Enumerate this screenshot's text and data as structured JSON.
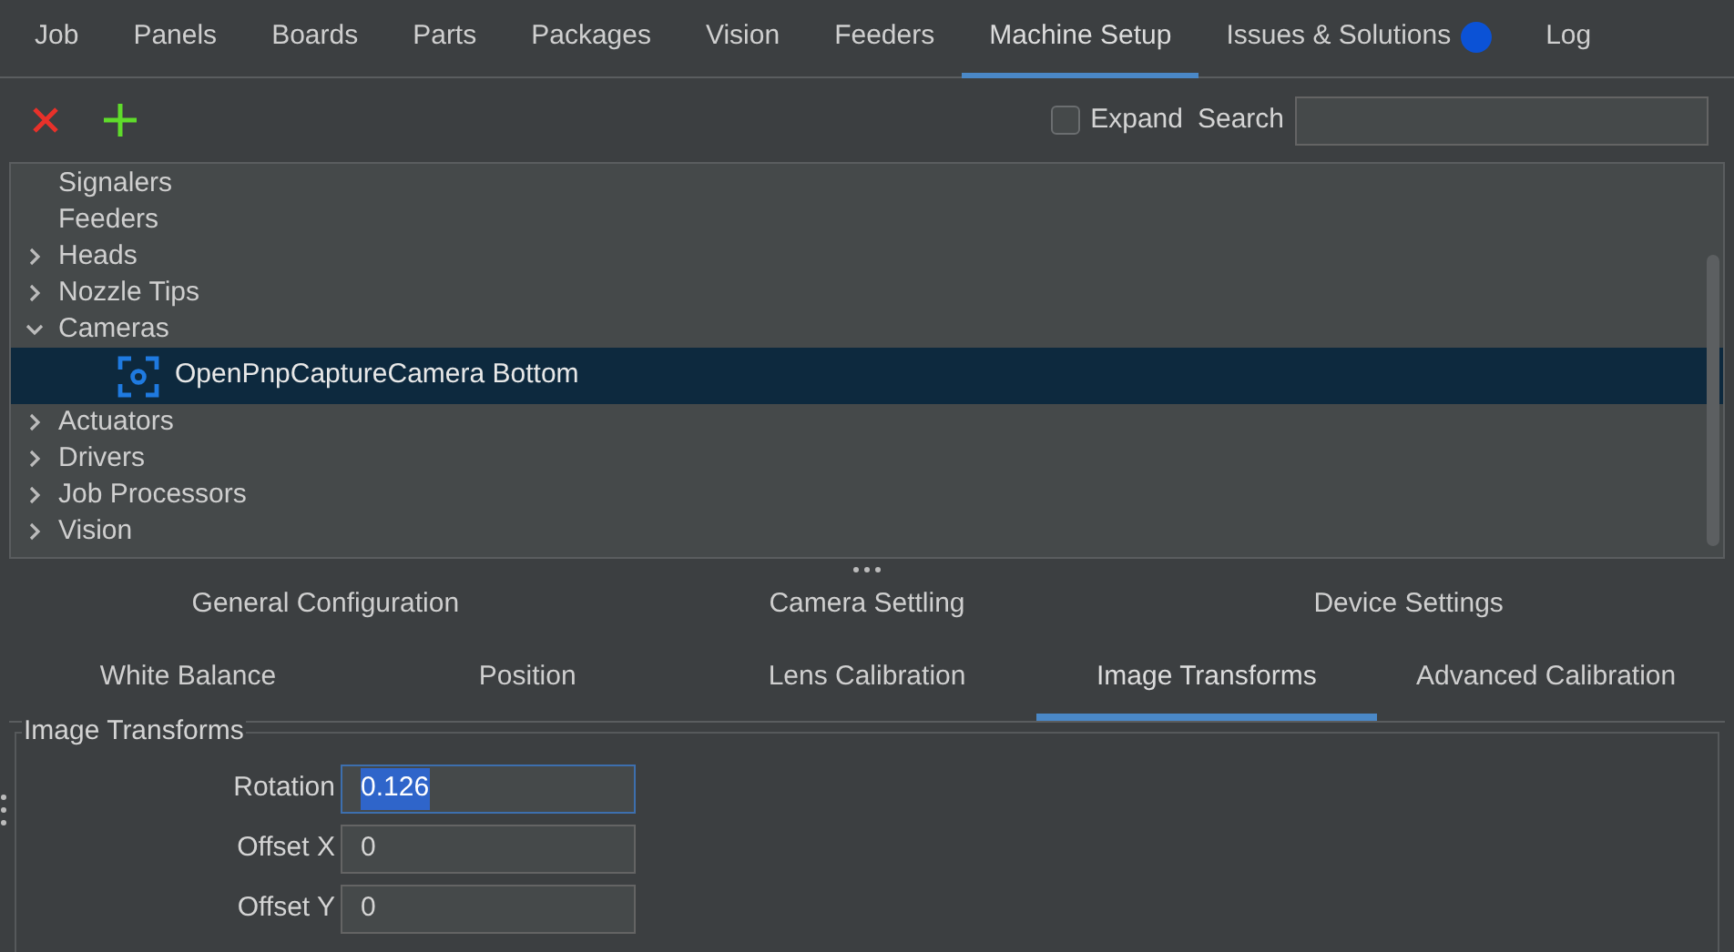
{
  "tabs": [
    {
      "label": "Job",
      "selected": false
    },
    {
      "label": "Panels",
      "selected": false
    },
    {
      "label": "Boards",
      "selected": false
    },
    {
      "label": "Parts",
      "selected": false
    },
    {
      "label": "Packages",
      "selected": false
    },
    {
      "label": "Vision",
      "selected": false
    },
    {
      "label": "Feeders",
      "selected": false
    },
    {
      "label": "Machine Setup",
      "selected": true
    },
    {
      "label": "Issues & Solutions",
      "selected": false,
      "color": "#0b52d6"
    },
    {
      "label": "Log",
      "selected": false
    }
  ],
  "toolbar": {
    "expand": {
      "label": "Expand",
      "checked": false
    },
    "search": {
      "label": "Search"
    }
  },
  "tree": [
    {
      "label": "Signalers",
      "kind": "leaf",
      "selected": false
    },
    {
      "label": "Feeders",
      "kind": "leaf",
      "selected": false
    },
    {
      "label": "Heads",
      "kind": "group",
      "expanded": false,
      "selected": false
    },
    {
      "label": "Nozzle Tips",
      "kind": "group",
      "expanded": false,
      "selected": false
    },
    {
      "label": "Cameras",
      "kind": "group",
      "expanded": true,
      "selected": false,
      "children": [
        {
          "label": "OpenPnpCaptureCamera Bottom",
          "kind": "camera",
          "selected": true
        }
      ]
    },
    {
      "label": "Actuators",
      "kind": "group",
      "expanded": false,
      "selected": false
    },
    {
      "label": "Drivers",
      "kind": "group",
      "expanded": false,
      "selected": false
    },
    {
      "label": "Job Processors",
      "kind": "group",
      "expanded": false,
      "selected": false
    },
    {
      "label": "Vision",
      "kind": "group",
      "expanded": false,
      "selected": false
    }
  ],
  "subtabs_row_1": [
    {
      "label": "General Configuration",
      "selected": false
    },
    {
      "label": "Camera Settling",
      "selected": false
    },
    {
      "label": "Device Settings",
      "selected": false
    }
  ],
  "subtabs_row_2": [
    {
      "label": "White Balance",
      "selected": false
    },
    {
      "label": "Position",
      "selected": false
    },
    {
      "label": "Lens Calibration",
      "selected": false
    },
    {
      "label": "Image Transforms",
      "selected": true
    },
    {
      "label": "Advanced Calibration",
      "selected": false
    }
  ],
  "group": {
    "title": "Image Transforms",
    "fields": [
      {
        "label": "Rotation",
        "value": "0.126",
        "focused": true
      },
      {
        "label": "Offset X",
        "value": "0",
        "focused": false
      },
      {
        "label": "Offset Y",
        "value": "0",
        "focused": false
      }
    ]
  }
}
